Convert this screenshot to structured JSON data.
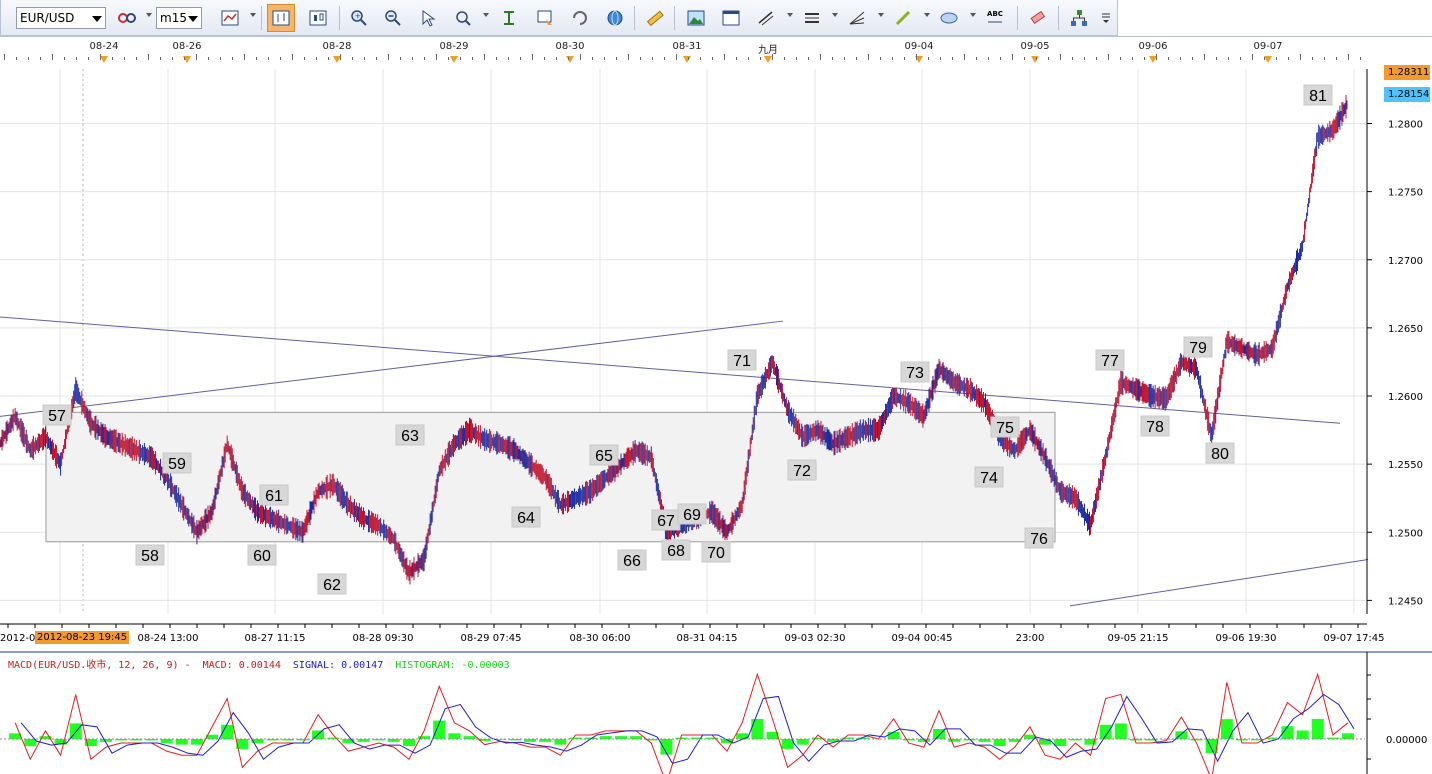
{
  "toolbar": {
    "symbol": "EUR/USD",
    "timeframe": "m15",
    "buttons": [
      {
        "name": "link-icon"
      },
      {
        "name": "bar-chart-icon"
      },
      {
        "name": "candle-chart-icon"
      },
      {
        "name": "line-chart-icon"
      },
      {
        "name": "zoom-in-icon"
      },
      {
        "name": "zoom-out-icon"
      },
      {
        "name": "cursor-icon"
      },
      {
        "name": "magnifier-icon"
      },
      {
        "name": "period-separator-icon"
      },
      {
        "name": "template-icon"
      },
      {
        "name": "refresh-icon"
      },
      {
        "name": "globe-icon"
      },
      {
        "name": "ruler-icon"
      },
      {
        "name": "image-icon"
      },
      {
        "name": "window-icon"
      },
      {
        "name": "line-tool-icon"
      },
      {
        "name": "channel-tool-icon"
      },
      {
        "name": "fan-tool-icon"
      },
      {
        "name": "pen-icon"
      },
      {
        "name": "ellipse-icon"
      },
      {
        "name": "text-abc-icon"
      },
      {
        "name": "eraser-icon"
      },
      {
        "name": "tree-icon"
      },
      {
        "name": "menu-icon"
      }
    ],
    "abc_label": "ABC"
  },
  "date_header": [
    "08-24",
    "08-26",
    "08-28",
    "08-29",
    "08-30",
    "08-31",
    "九月",
    "09-04",
    "09-05",
    "09-06",
    "09-07"
  ],
  "price_tags": {
    "high": "1.28311",
    "current": "1.28154"
  },
  "price_axis": [
    "1.2800",
    "1.2750",
    "1.2700",
    "1.2650",
    "1.2600",
    "1.2550",
    "1.2500",
    "1.2450"
  ],
  "time_axis": [
    "2012-0",
    "08-24 13:00",
    "08-27 11:15",
    "08-28 09:30",
    "08-29 07:45",
    "08-30 06:00",
    "08-31 04:15",
    "09-03 02:30",
    "09-04 00:45",
    "23:00",
    "09-05 21:15",
    "09-06 19:30",
    "09-07 17:45"
  ],
  "cursor_time": "2012-08-23 19:45",
  "wave_labels": [
    "57",
    "58",
    "59",
    "60",
    "61",
    "62",
    "63",
    "64",
    "65",
    "66",
    "67",
    "68",
    "69",
    "70",
    "71",
    "72",
    "73",
    "74",
    "75",
    "76",
    "77",
    "78",
    "79",
    "80",
    "81"
  ],
  "macd": {
    "title": "MACD(EUR/USD.收市, 12, 26, 9) -",
    "macd_text": "MACD: 0.00144",
    "signal_text": "SIGNAL: 0.00147",
    "histogram_text": "HISTOGRAM: -0.00003",
    "zero_label": "0.00000",
    "colors": {
      "macd": "#e02020",
      "signal": "#2020c0",
      "histogram": "#22ff22"
    }
  },
  "chart_data": {
    "type": "line",
    "title": "",
    "series_name": "EUR/USD",
    "ylim": [
      1.244,
      1.284
    ],
    "points": [
      [
        0,
        1.2565
      ],
      [
        1,
        1.2585
      ],
      [
        2,
        1.256
      ],
      [
        3,
        1.257
      ],
      [
        4,
        1.255
      ],
      [
        5,
        1.2605
      ],
      [
        6,
        1.258
      ],
      [
        7,
        1.257
      ],
      [
        8,
        1.2565
      ],
      [
        9,
        1.256
      ],
      [
        10,
        1.2555
      ],
      [
        11,
        1.254
      ],
      [
        12,
        1.252
      ],
      [
        13,
        1.25
      ],
      [
        14,
        1.2515
      ],
      [
        15,
        1.2565
      ],
      [
        16,
        1.253
      ],
      [
        17,
        1.2515
      ],
      [
        18,
        1.251
      ],
      [
        19,
        1.2505
      ],
      [
        20,
        1.25
      ],
      [
        21,
        1.253
      ],
      [
        22,
        1.2535
      ],
      [
        23,
        1.252
      ],
      [
        24,
        1.251
      ],
      [
        25,
        1.2505
      ],
      [
        26,
        1.2495
      ],
      [
        27,
        1.247
      ],
      [
        28,
        1.248
      ],
      [
        29,
        1.2545
      ],
      [
        30,
        1.2565
      ],
      [
        31,
        1.2575
      ],
      [
        32,
        1.2568
      ],
      [
        33,
        1.2565
      ],
      [
        34,
        1.256
      ],
      [
        35,
        1.255
      ],
      [
        36,
        1.254
      ],
      [
        37,
        1.252
      ],
      [
        38,
        1.2525
      ],
      [
        39,
        1.253
      ],
      [
        40,
        1.254
      ],
      [
        41,
        1.255
      ],
      [
        42,
        1.256
      ],
      [
        43,
        1.2555
      ],
      [
        44,
        1.25
      ],
      [
        45,
        1.2505
      ],
      [
        46,
        1.251
      ],
      [
        47,
        1.2515
      ],
      [
        48,
        1.25
      ],
      [
        49,
        1.252
      ],
      [
        50,
        1.26
      ],
      [
        51,
        1.2625
      ],
      [
        52,
        1.259
      ],
      [
        53,
        1.257
      ],
      [
        54,
        1.2575
      ],
      [
        55,
        1.2565
      ],
      [
        56,
        1.257
      ],
      [
        57,
        1.2575
      ],
      [
        58,
        1.2575
      ],
      [
        59,
        1.26
      ],
      [
        60,
        1.2595
      ],
      [
        61,
        1.2585
      ],
      [
        62,
        1.262
      ],
      [
        63,
        1.261
      ],
      [
        64,
        1.2605
      ],
      [
        65,
        1.2595
      ],
      [
        66,
        1.257
      ],
      [
        67,
        1.256
      ],
      [
        68,
        1.2575
      ],
      [
        69,
        1.2555
      ],
      [
        70,
        1.253
      ],
      [
        71,
        1.2525
      ],
      [
        72,
        1.2505
      ],
      [
        73,
        1.2555
      ],
      [
        74,
        1.261
      ],
      [
        75,
        1.2605
      ],
      [
        76,
        1.26
      ],
      [
        77,
        1.2598
      ],
      [
        78,
        1.2625
      ],
      [
        79,
        1.262
      ],
      [
        80,
        1.257
      ],
      [
        81,
        1.264
      ],
      [
        82,
        1.2635
      ],
      [
        83,
        1.263
      ],
      [
        84,
        1.2635
      ],
      [
        85,
        1.268
      ],
      [
        86,
        1.271
      ],
      [
        87,
        1.279
      ],
      [
        88,
        1.2795
      ],
      [
        89,
        1.2815
      ]
    ]
  }
}
